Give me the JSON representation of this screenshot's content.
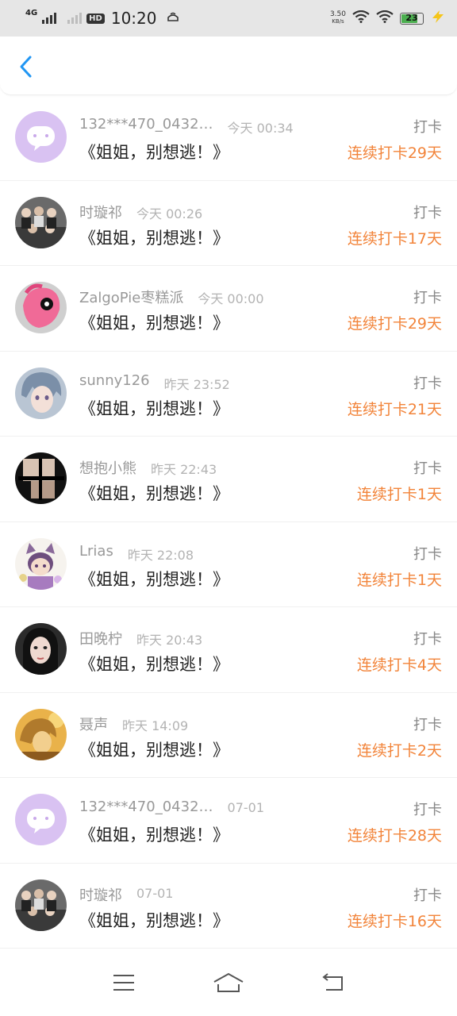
{
  "status_bar": {
    "network": "4G",
    "hd": "HD",
    "time": "10:20",
    "speed_value": "3.50",
    "speed_unit": "KB/s",
    "battery": "23"
  },
  "items": [
    {
      "name": "132***470_0432…",
      "time": "今天 00:34",
      "kind": "打卡",
      "title": "《姐姐，别想逃！》",
      "streak": "连续打卡29天",
      "avatar": "default-chat-avatar"
    },
    {
      "name": "时璇祁",
      "time": "今天 00:26",
      "kind": "打卡",
      "title": "《姐姐，别想逃！》",
      "streak": "连续打卡17天",
      "avatar": "group-photo-avatar"
    },
    {
      "name": "ZalgoPie枣糕派",
      "time": "今天 00:00",
      "kind": "打卡",
      "title": "《姐姐，别想逃！》",
      "streak": "连续打卡29天",
      "avatar": "pink-pony-avatar"
    },
    {
      "name": "sunny126",
      "time": "昨天 23:52",
      "kind": "打卡",
      "title": "《姐姐，别想逃！》",
      "streak": "连续打卡21天",
      "avatar": "anime-boy-avatar"
    },
    {
      "name": "想抱小熊",
      "time": "昨天 22:43",
      "kind": "打卡",
      "title": "《姐姐，别想逃！》",
      "streak": "连续打卡1天",
      "avatar": "dark-photo-avatar"
    },
    {
      "name": "Lrias",
      "time": "昨天 22:08",
      "kind": "打卡",
      "title": "《姐姐，别想逃！》",
      "streak": "连续打卡1天",
      "avatar": "cat-ears-avatar"
    },
    {
      "name": "田晚柠",
      "time": "昨天 20:43",
      "kind": "打卡",
      "title": "《姐姐，别想逃！》",
      "streak": "连续打卡4天",
      "avatar": "girl-portrait-avatar"
    },
    {
      "name": "聂声",
      "time": "昨天 14:09",
      "kind": "打卡",
      "title": "《姐姐，别想逃！》",
      "streak": "连续打卡2天",
      "avatar": "golden-anime-avatar"
    },
    {
      "name": "132***470_0432…",
      "time": "07-01",
      "kind": "打卡",
      "title": "《姐姐，别想逃！》",
      "streak": "连续打卡28天",
      "avatar": "default-chat-avatar"
    },
    {
      "name": "时璇祁",
      "time": "07-01",
      "kind": "打卡",
      "title": "《姐姐，别想逃！》",
      "streak": "连续打卡16天",
      "avatar": "group-photo-avatar"
    }
  ],
  "colors": {
    "accent_orange": "#f2843a",
    "back_blue": "#2196f3",
    "default_avatar_purple": "#d9c2f2"
  }
}
